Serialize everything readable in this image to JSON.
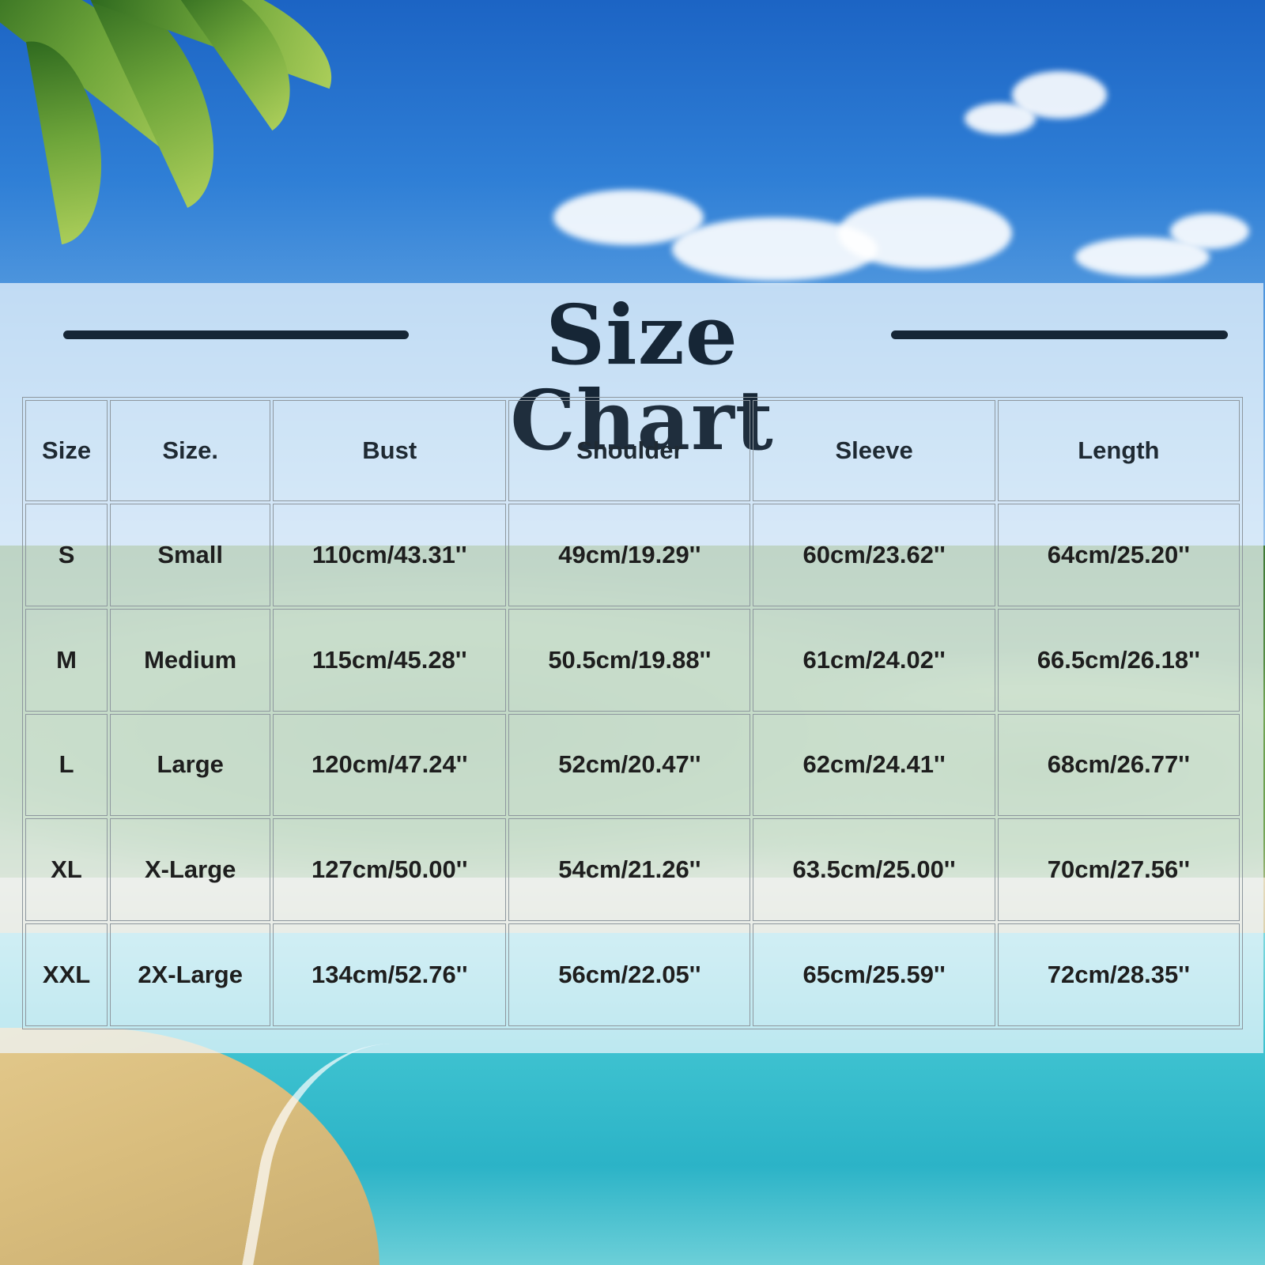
{
  "title": "Size Chart",
  "table": {
    "headers": [
      "Size",
      "Size.",
      "Bust",
      "Shoulder",
      "Sleeve",
      "Length"
    ],
    "rows": [
      [
        "S",
        "Small",
        "110cm/43.31''",
        "49cm/19.29''",
        "60cm/23.62''",
        "64cm/25.20''"
      ],
      [
        "M",
        "Medium",
        "115cm/45.28''",
        "50.5cm/19.88''",
        "61cm/24.02''",
        "66.5cm/26.18''"
      ],
      [
        "L",
        "Large",
        "120cm/47.24''",
        "52cm/20.47''",
        "62cm/24.41''",
        "68cm/26.77''"
      ],
      [
        "XL",
        "X-Large",
        "127cm/50.00''",
        "54cm/21.26''",
        "63.5cm/25.00''",
        "70cm/27.56''"
      ],
      [
        "XXL",
        "2X-Large",
        "134cm/52.76''",
        "56cm/22.05''",
        "65cm/25.59''",
        "72cm/28.35''"
      ]
    ]
  },
  "colors": {
    "title": "#162636",
    "grid": "#8e979e",
    "text": "#1e1e1e"
  }
}
